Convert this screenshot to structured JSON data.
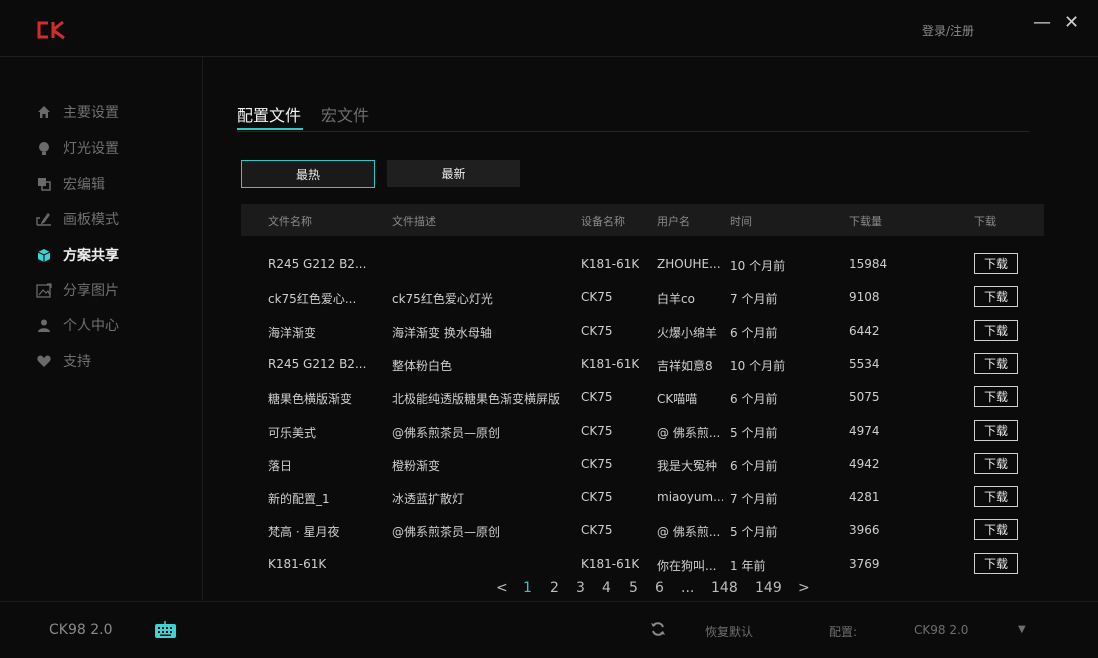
{
  "header": {
    "login_label": "登录/注册",
    "minimize_glyph": "—",
    "close_glyph": "✕",
    "logo_icon": "ck-logo"
  },
  "sidebar": {
    "items": [
      {
        "label": "主要设置",
        "icon": "home-icon"
      },
      {
        "label": "灯光设置",
        "icon": "bulb-icon"
      },
      {
        "label": "宏编辑",
        "icon": "macro-icon"
      },
      {
        "label": "画板模式",
        "icon": "drawing-board-icon"
      },
      {
        "label": "方案共享",
        "icon": "cube-icon",
        "active": true
      },
      {
        "label": "分享图片",
        "icon": "image-share-icon"
      },
      {
        "label": "个人中心",
        "icon": "user-icon"
      },
      {
        "label": "支持",
        "icon": "heart-icon"
      }
    ]
  },
  "tabs": [
    {
      "label": "配置文件",
      "active": true
    },
    {
      "label": "宏文件"
    }
  ],
  "filters": {
    "hot_label": "最热",
    "new_label": "最新"
  },
  "table": {
    "columns": [
      "文件名称",
      "文件描述",
      "设备名称",
      "用户名",
      "时间",
      "下载量",
      "下载"
    ],
    "download_label": "下载",
    "rows": [
      {
        "name": "R245 G212 B2...",
        "desc": "",
        "device": "K181-61K",
        "user": "ZHOUHE...",
        "time": "10 个月前",
        "downloads": "15984"
      },
      {
        "name": "ck75红色爱心...",
        "desc": "ck75红色爱心灯光",
        "device": "CK75",
        "user": "白羊co",
        "time": "7 个月前",
        "downloads": "9108"
      },
      {
        "name": "海洋渐变",
        "desc": "海洋渐变 换水母轴",
        "device": "CK75",
        "user": "火爆小绵羊",
        "time": "6 个月前",
        "downloads": "6442"
      },
      {
        "name": "R245 G212 B2...",
        "desc": "整体粉白色",
        "device": "K181-61K",
        "user": "吉祥如意8",
        "time": "10 个月前",
        "downloads": "5534"
      },
      {
        "name": "糖果色横版渐变",
        "desc": "北极能纯透版糖果色渐变横屏版",
        "device": "CK75",
        "user": "CK喵喵",
        "time": "6 个月前",
        "downloads": "5075"
      },
      {
        "name": "可乐美式",
        "desc": "@佛系煎茶员—原创",
        "device": "CK75",
        "user": "@ 佛系煎...",
        "time": "5 个月前",
        "downloads": "4974"
      },
      {
        "name": "落日",
        "desc": "橙粉渐变",
        "device": "CK75",
        "user": "我是大冤种",
        "time": "6 个月前",
        "downloads": "4942"
      },
      {
        "name": "新的配置_1",
        "desc": "冰透蓝扩散灯",
        "device": "CK75",
        "user": "miaoyum...",
        "time": "7 个月前",
        "downloads": "4281"
      },
      {
        "name": "梵高 · 星月夜",
        "desc": "@佛系煎茶员—原创",
        "device": "CK75",
        "user": "@ 佛系煎...",
        "time": "5 个月前",
        "downloads": "3966"
      },
      {
        "name": "K181-61K",
        "desc": "",
        "device": "K181-61K",
        "user": "你在狗叫...",
        "time": "1 年前",
        "downloads": "3769"
      }
    ]
  },
  "pagination": {
    "prev": "<",
    "pages": [
      "1",
      "2",
      "3",
      "4",
      "5",
      "6",
      "...",
      "148",
      "149"
    ],
    "current": "1",
    "next": ">"
  },
  "footer": {
    "model": "CK98 2.0",
    "keyboard_icon": "keyboard-icon",
    "refresh_icon": "refresh-icon",
    "restore_label": "恢复默认",
    "config_label": "配置:",
    "config_value": "CK98 2.0",
    "dropdown_glyph": "▼"
  },
  "colors": {
    "accent": "#2ec9c4",
    "background": "#0b0b0b",
    "logo_red": "#d62b2b"
  }
}
